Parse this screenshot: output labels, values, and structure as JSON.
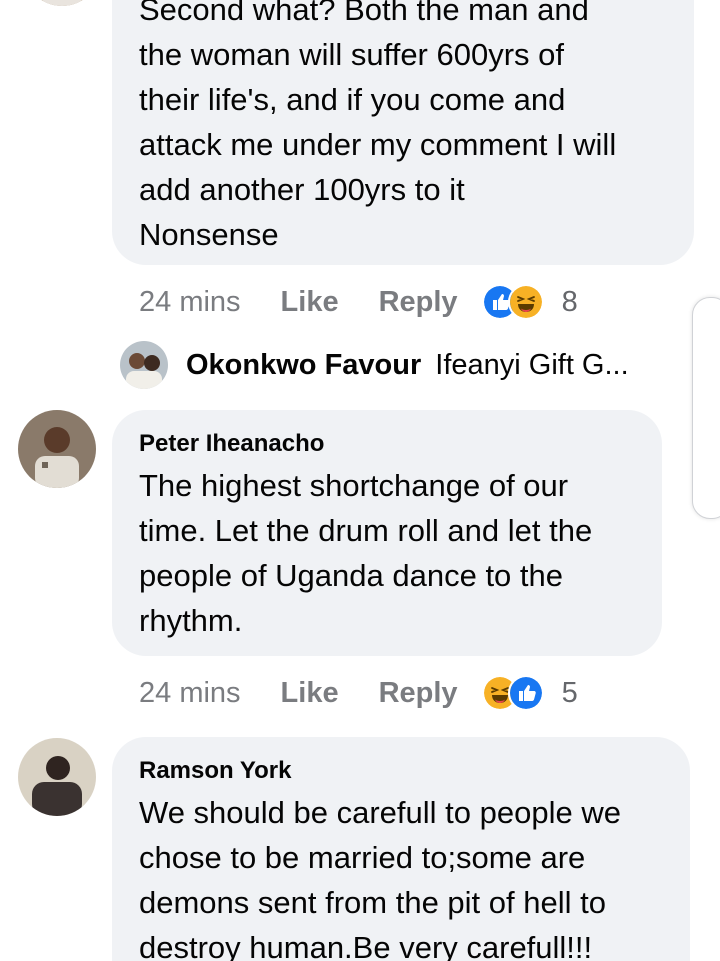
{
  "colors": {
    "bubble_bg": "#f0f2f5",
    "meta_text": "#65676b",
    "like_blue": "#1877f2",
    "haha_yellow": "#f7b125"
  },
  "comments": [
    {
      "author": "",
      "text": "Second what?  Both the man and\nthe woman will suffer 600yrs of\ntheir life's,  and if you come and\nattack me under my comment I will\nadd another 100yrs to it\nNonsense",
      "time": "24 mins",
      "like_label": "Like",
      "reply_label": "Reply",
      "reactions": [
        "like-reaction-icon",
        "haha-reaction-icon"
      ],
      "reaction_count": "8"
    },
    {
      "author": "Peter Iheanacho",
      "text": "The highest shortchange of our\ntime. Let the drum roll and let the\npeople of Uganda dance to the\nrhythm.",
      "time": "24 mins",
      "like_label": "Like",
      "reply_label": "Reply",
      "reactions": [
        "haha-reaction-icon",
        "like-reaction-icon"
      ],
      "reaction_count": "5"
    },
    {
      "author": "Ramson York",
      "text": "We should be carefull to people we\nchose to be married to;some are\ndemons sent from the pit of hell to\ndestroy human.Be very carefull!!!",
      "time": "",
      "like_label": "",
      "reply_label": "",
      "reactions": [],
      "reaction_count": ""
    }
  ],
  "reply_preview": {
    "name": "Okonkwo Favour",
    "snippet": "Ifeanyi Gift G..."
  }
}
